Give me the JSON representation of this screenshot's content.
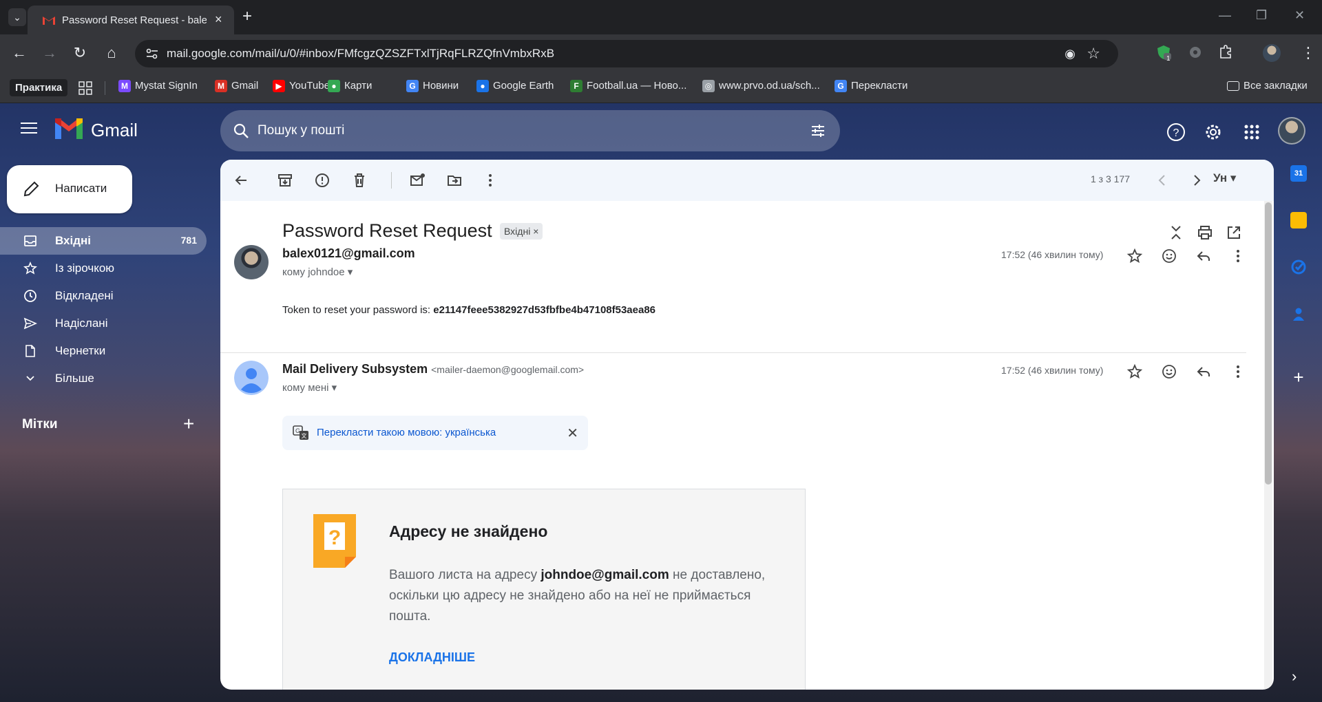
{
  "browser": {
    "tab_title": "Password Reset Request - balex",
    "new_tab": "+",
    "url": "mail.google.com/mail/u/0/#inbox/FMfcgzQZSZFTxlTjRqFLRZQfnVmbxRxB",
    "extension_badge": "1",
    "bookmarks": {
      "practice": "Практика",
      "items": [
        {
          "label": "Mystat SignIn",
          "icon": "M",
          "color": "#7b4bff"
        },
        {
          "label": "Gmail",
          "icon": "M",
          "color": "#d93025"
        },
        {
          "label": "YouTube",
          "icon": "▶",
          "color": "#ff0000"
        },
        {
          "label": "Карти",
          "icon": "●",
          "color": "#34a853"
        },
        {
          "label": "Новини",
          "icon": "G",
          "color": "#4285f4"
        },
        {
          "label": "Google Earth",
          "icon": "●",
          "color": "#1a73e8"
        },
        {
          "label": "Football.ua — Ново...",
          "icon": "F",
          "color": "#2e7d32"
        },
        {
          "label": "www.prvo.od.ua/sch...",
          "icon": "◎",
          "color": "#9aa0a6"
        },
        {
          "label": "Перекласти",
          "icon": "G",
          "color": "#4285f4"
        }
      ],
      "all_bookmarks": "Все закладки"
    }
  },
  "gmail": {
    "brand": "Gmail",
    "search_placeholder": "Пошук у пошті",
    "compose": "Написати",
    "nav": [
      {
        "label": "Вхідні",
        "count": "781",
        "icon": "inbox-icon"
      },
      {
        "label": "Із зірочкою",
        "count": "",
        "icon": "star-icon"
      },
      {
        "label": "Відкладені",
        "count": "",
        "icon": "clock-icon"
      },
      {
        "label": "Надіслані",
        "count": "",
        "icon": "send-icon"
      },
      {
        "label": "Чернетки",
        "count": "",
        "icon": "draft-icon"
      },
      {
        "label": "Більше",
        "count": "",
        "icon": "chevron-down-icon"
      }
    ],
    "labels_title": "Мітки",
    "labels_add": "+"
  },
  "toolbar": {
    "pager": "1 з 3 177",
    "language": "Ун"
  },
  "thread": {
    "subject": "Password Reset Request",
    "chip": "Вхідні ×",
    "messages": [
      {
        "sender": "balex0121@gmail.com",
        "sender_email": "",
        "to": "кому johndoe",
        "time": "17:52 (46 хвилин тому)",
        "body_prefix": "Token to reset your password is: ",
        "body_token": "e21147feee5382927d53fbfbe4b47108f53aea86"
      },
      {
        "sender": "Mail Delivery Subsystem",
        "sender_email": "<mailer-daemon@googlemail.com>",
        "to": "кому мені",
        "time": "17:52 (46 хвилин тому)"
      }
    ],
    "translate_bar": "Перекласти такою мовою: українська",
    "bounce": {
      "title": "Адресу не знайдено",
      "text_before": "Вашого листа на адресу ",
      "address": "johndoe@gmail.com",
      "text_after": " не доставлено, оскільки цю адресу не знайдено або на неї не приймається пошта.",
      "link": "ДОКЛАДНІШЕ"
    }
  },
  "colors": {
    "accent_blue": "#0b57d0",
    "link_blue": "#1a73e8",
    "bounce_icon": "#f9a825"
  }
}
